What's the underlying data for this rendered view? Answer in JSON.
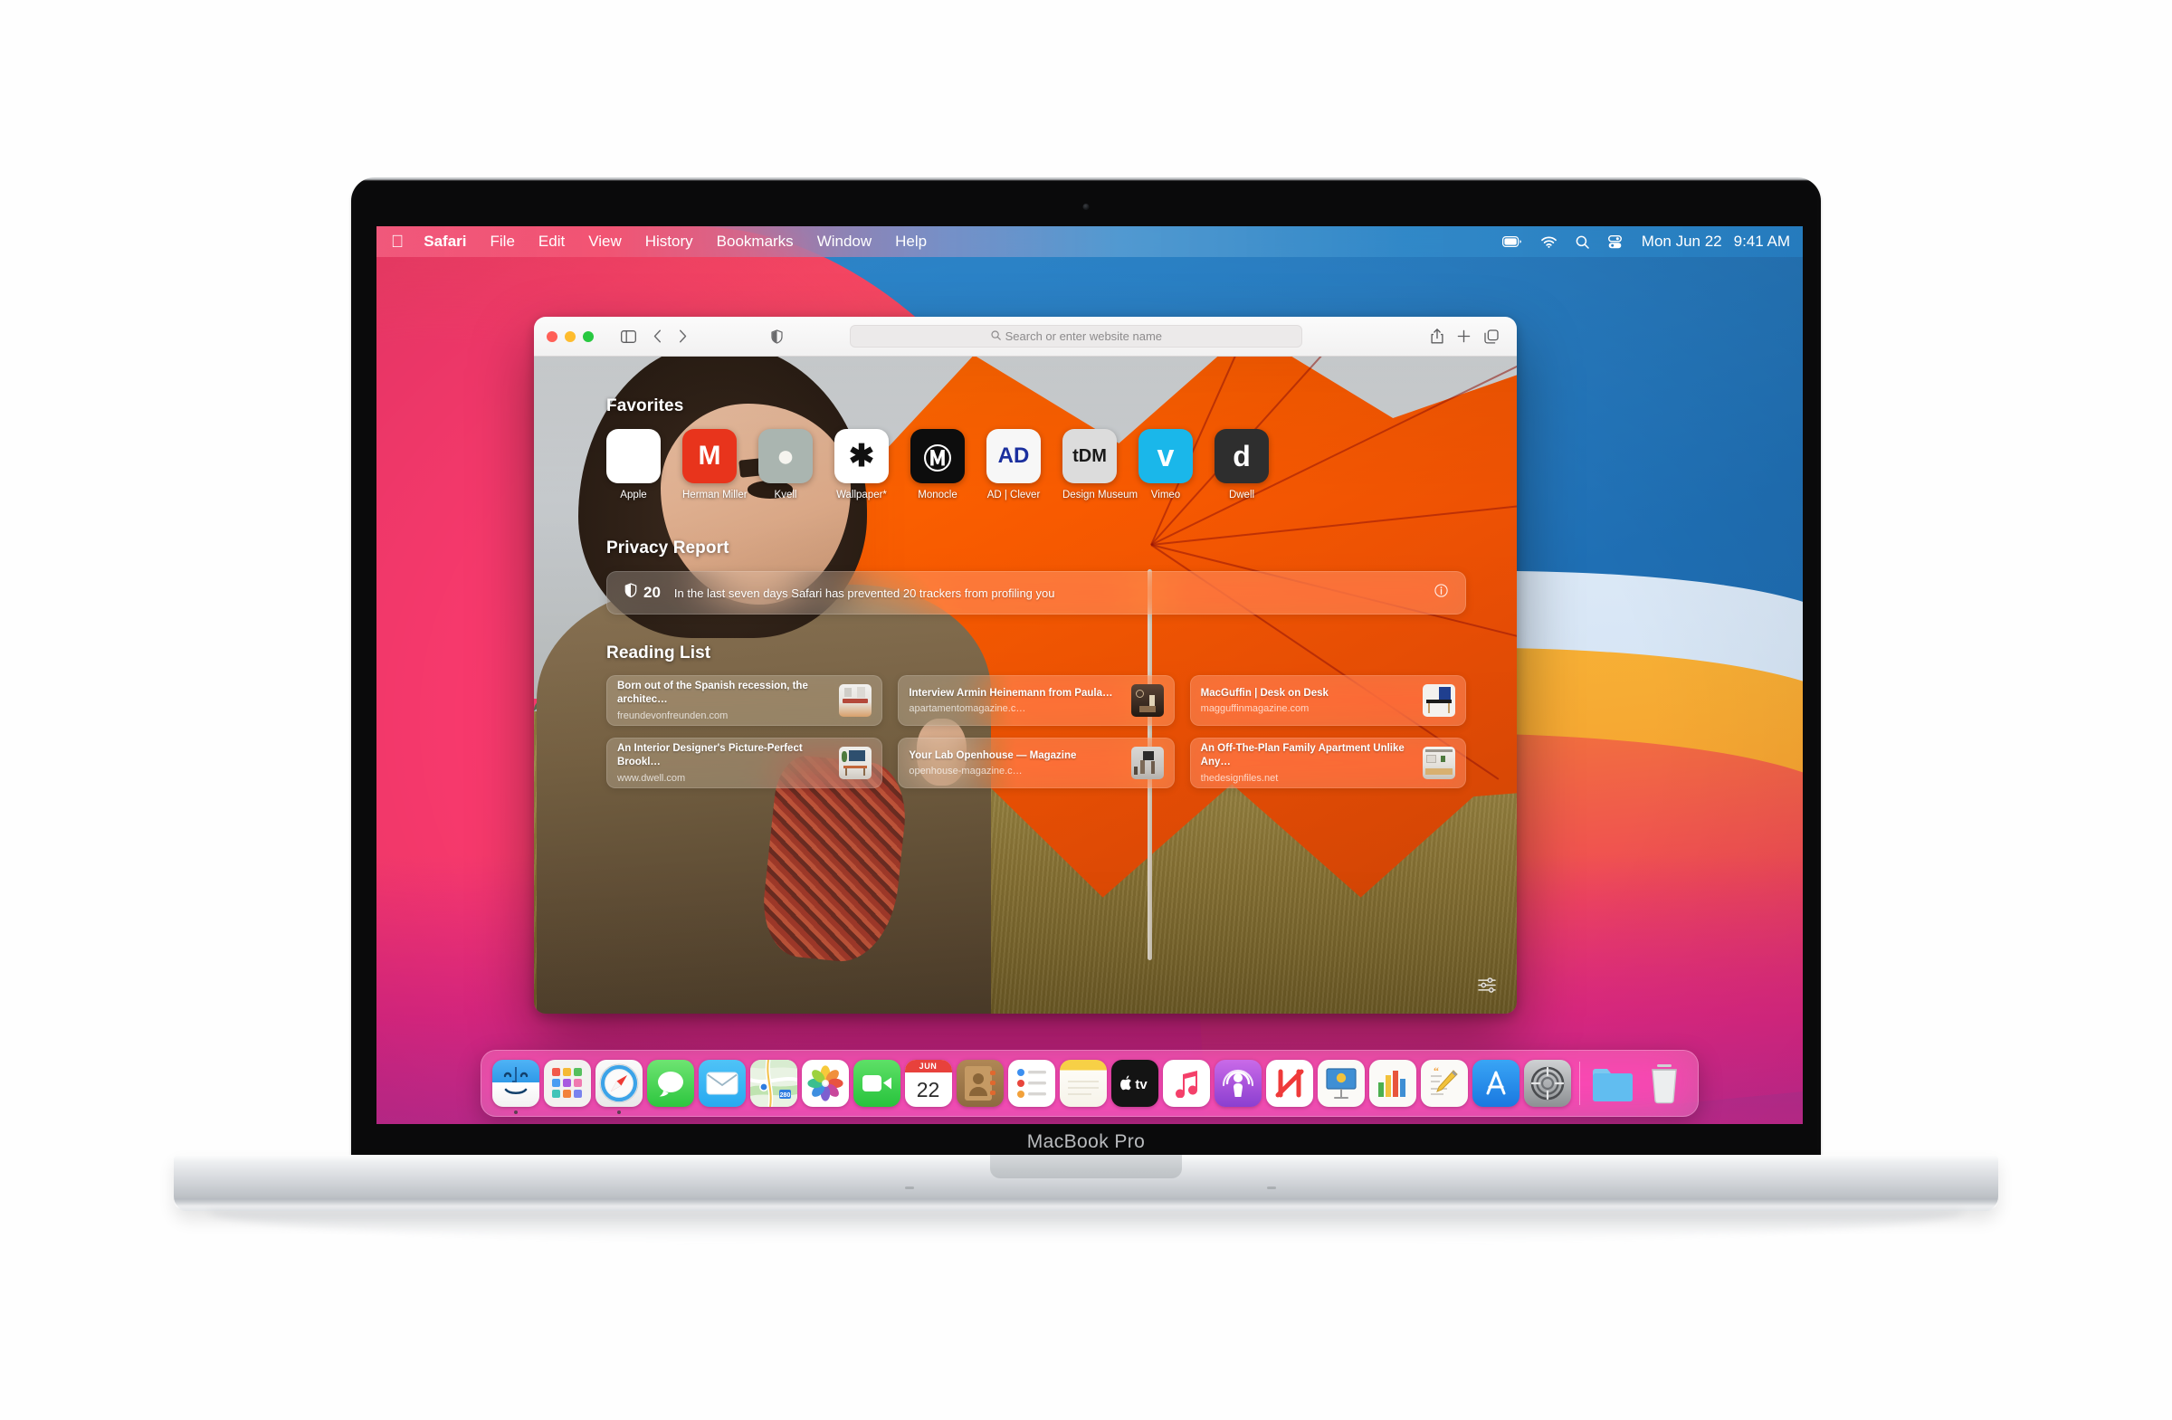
{
  "device": {
    "model_label": "MacBook Pro"
  },
  "menubar": {
    "apple_icon": "apple-logo-icon",
    "items": [
      {
        "label": "Safari",
        "bold": true
      },
      {
        "label": "File",
        "bold": false
      },
      {
        "label": "Edit",
        "bold": false
      },
      {
        "label": "View",
        "bold": false
      },
      {
        "label": "History",
        "bold": false
      },
      {
        "label": "Bookmarks",
        "bold": false
      },
      {
        "label": "Window",
        "bold": false
      },
      {
        "label": "Help",
        "bold": false
      }
    ],
    "status_icons": [
      "battery-icon",
      "wifi-icon",
      "search-icon",
      "control-center-icon"
    ],
    "date": "Mon Jun 22",
    "time": "9:41 AM"
  },
  "safari": {
    "window_controls": [
      "close-button",
      "minimize-button",
      "zoom-button"
    ],
    "toolbar": {
      "sidebar_icon": "sidebar-toggle-icon",
      "back_icon": "back-chevron-icon",
      "forward_icon": "forward-chevron-icon",
      "privacy_icon": "privacy-shield-icon",
      "share_icon": "share-icon",
      "new_tab_icon": "plus-icon",
      "tab_overview_icon": "tab-overview-icon"
    },
    "address_bar": {
      "placeholder": "Search or enter website name",
      "value": "",
      "icon": "search-icon"
    },
    "start_page": {
      "favorites_heading": "Favorites",
      "favorites": [
        {
          "label": "Apple",
          "glyph": "",
          "bg": "#ffffff",
          "fg": "#6e6e73",
          "size": 30
        },
        {
          "label": "Herman Miller",
          "glyph": "M",
          "bg": "#e8341c",
          "fg": "#ffffff",
          "size": 30
        },
        {
          "label": "Kvell",
          "glyph": "●",
          "bg": "#aab5b0",
          "fg": "#f5f4ef",
          "size": 34
        },
        {
          "label": "Wallpaper*",
          "glyph": "✱",
          "bg": "#ffffff",
          "fg": "#111111",
          "size": 34
        },
        {
          "label": "Monocle",
          "glyph": "Ⓜ",
          "bg": "#0d0d0d",
          "fg": "#ffffff",
          "size": 31
        },
        {
          "label": "AD | Clever",
          "glyph": "AD",
          "bg": "#f7f7f7",
          "fg": "#1b2f9e",
          "size": 24
        },
        {
          "label": "Design Museum",
          "glyph": "tDM",
          "bg": "#dcdcdc",
          "fg": "#1a1a1a",
          "size": 20
        },
        {
          "label": "Vimeo",
          "glyph": "v",
          "bg": "#1ab7ea",
          "fg": "#ffffff",
          "size": 34
        },
        {
          "label": "Dwell",
          "glyph": "d",
          "bg": "#2e2e2e",
          "fg": "#ffffff",
          "size": 32
        }
      ],
      "privacy_heading": "Privacy Report",
      "privacy": {
        "shield_icon": "privacy-shield-icon",
        "count": "20",
        "message": "In the last seven days Safari has prevented 20 trackers from profiling you",
        "info_icon": "info-circle-icon"
      },
      "reading_heading": "Reading List",
      "reading_list": [
        {
          "title": "Born out of the Spanish recession, the architec…",
          "url": "freundevonfreunden.com",
          "thumb": "interior-white-room"
        },
        {
          "title": "Interview Armin Heinemann from Paula…",
          "url": "apartamentomagazine.c…",
          "thumb": "dark-still-life"
        },
        {
          "title": "MacGuffin | Desk on Desk",
          "url": "magguffinmagazine.com",
          "thumb": "blue-desk"
        },
        {
          "title": "An Interior Designer's Picture-Perfect Brookl…",
          "url": "www.dwell.com",
          "thumb": "living-room"
        },
        {
          "title": "Your Lab Openhouse — Magazine",
          "url": "openhouse-magazine.c…",
          "thumb": "figures-grey"
        },
        {
          "title": "An Off-The-Plan Family Apartment Unlike Any…",
          "url": "thedesignfiles.net",
          "thumb": "kitchen"
        }
      ],
      "settings_icon": "sliders-icon"
    }
  },
  "dock": {
    "items": [
      {
        "name": "finder",
        "label": "Finder",
        "running": true
      },
      {
        "name": "launchpad",
        "label": "Launchpad",
        "running": false
      },
      {
        "name": "safari",
        "label": "Safari",
        "running": true
      },
      {
        "name": "messages",
        "label": "Messages",
        "running": false
      },
      {
        "name": "mail",
        "label": "Mail",
        "running": false
      },
      {
        "name": "maps",
        "label": "Maps",
        "running": false
      },
      {
        "name": "photos",
        "label": "Photos",
        "running": false
      },
      {
        "name": "facetime",
        "label": "FaceTime",
        "running": false
      },
      {
        "name": "calendar",
        "label": "Calendar",
        "running": false,
        "month": "JUN",
        "day": "22"
      },
      {
        "name": "contacts",
        "label": "Contacts",
        "running": false
      },
      {
        "name": "reminders",
        "label": "Reminders",
        "running": false
      },
      {
        "name": "notes",
        "label": "Notes",
        "running": false
      },
      {
        "name": "appletv",
        "label": "Apple TV",
        "running": false
      },
      {
        "name": "music",
        "label": "Music",
        "running": false
      },
      {
        "name": "podcasts",
        "label": "Podcasts",
        "running": false
      },
      {
        "name": "news",
        "label": "News",
        "running": false
      },
      {
        "name": "keynote",
        "label": "Keynote",
        "running": false
      },
      {
        "name": "numbers",
        "label": "Numbers",
        "running": false
      },
      {
        "name": "pages",
        "label": "Pages",
        "running": false
      },
      {
        "name": "appstore",
        "label": "App Store",
        "running": false
      },
      {
        "name": "system-preferences",
        "label": "System Preferences",
        "running": false
      }
    ],
    "separator": true,
    "trailing": [
      {
        "name": "downloads-folder",
        "label": "Downloads"
      },
      {
        "name": "trash",
        "label": "Trash"
      }
    ]
  },
  "colors": {
    "accent_orange": "#f2813c",
    "dock_bg": "rgba(255,255,255,0.22)",
    "traffic_red": "#ff5f57",
    "traffic_yellow": "#febc2e",
    "traffic_green": "#28c840"
  }
}
